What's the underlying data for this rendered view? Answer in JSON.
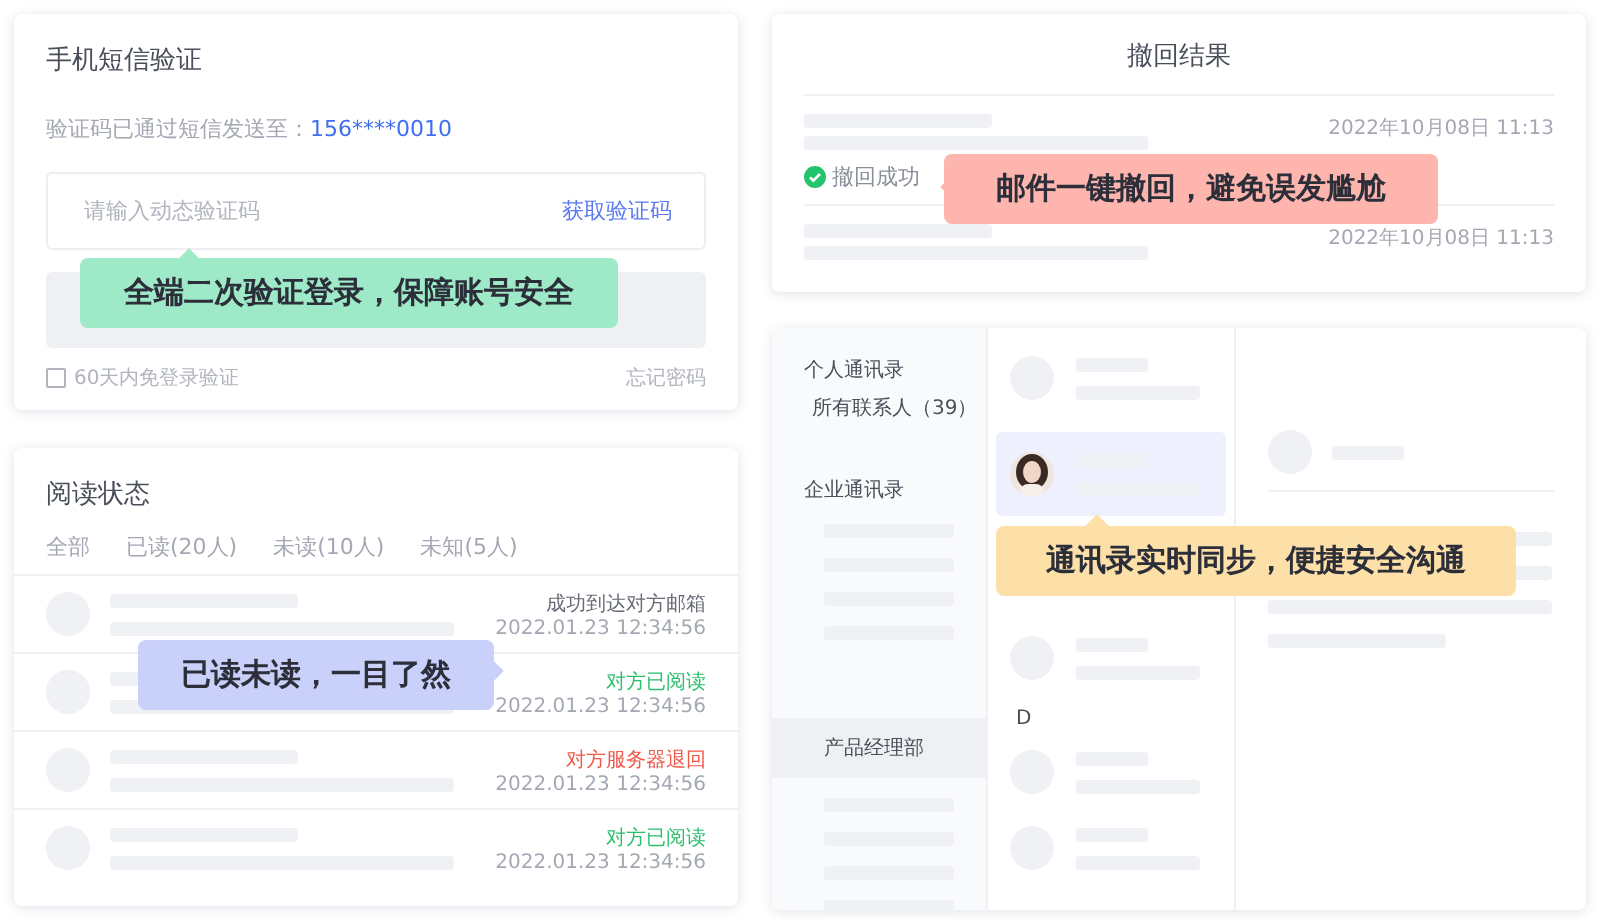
{
  "sms_card": {
    "title": "手机短信验证",
    "sent_label": "验证码已通过短信发送至：",
    "phone": "156****0010",
    "code_field": {
      "placeholder": "请输入动态验证码"
    },
    "get_code_link": "获取验证码",
    "remember": {
      "label": "60天内免登录验证",
      "checked": false
    },
    "forgot_link": "忘记密码",
    "callout": "全端二次验证登录，保障账号安全"
  },
  "recall_card": {
    "title": "撤回结果",
    "rows": [
      {
        "time": "2022年10月08日 11:13",
        "status": "撤回成功"
      },
      {
        "time": "2022年10月08日 11:13"
      }
    ],
    "callout": "邮件一键撤回，避免误发尴尬"
  },
  "read_card": {
    "title": "阅读状态",
    "tabs": [
      {
        "label": "全部",
        "selected": false
      },
      {
        "label": "已读(20人)",
        "selected": false
      },
      {
        "label": "未读(10人)",
        "selected": false
      },
      {
        "label": "未知(5人)",
        "selected": false
      }
    ],
    "rows": [
      {
        "kind": "delivered",
        "status": "成功到达对方邮箱",
        "time": "2022.01.23 12:34:56"
      },
      {
        "kind": "read",
        "status": "对方已阅读",
        "time": "2022.01.23 12:34:56"
      },
      {
        "kind": "bounced",
        "status": "对方服务器退回",
        "time": "2022.01.23 12:34:56"
      },
      {
        "kind": "read",
        "status": "对方已阅读",
        "time": "2022.01.23 12:34:56"
      }
    ],
    "callout": "已读未读，一目了然"
  },
  "contacts_card": {
    "sidebar": [
      {
        "title": "个人通讯录",
        "items": [
          {
            "label": "所有联系人（39）",
            "selected": false
          }
        ]
      },
      {
        "title": "企业通讯录",
        "items": [
          {
            "label": "产品经理部",
            "selected": true
          }
        ]
      }
    ],
    "list": [
      {
        "rows": [
          {
            "selected": false
          },
          {
            "selected": true,
            "kind": "picture"
          },
          {
            "selected": false
          }
        ]
      },
      {
        "letter": "D",
        "rows": [
          {
            "selected": false
          },
          {
            "selected": false
          }
        ]
      }
    ],
    "callout": "通讯录实时同步，便捷安全沟通"
  }
}
